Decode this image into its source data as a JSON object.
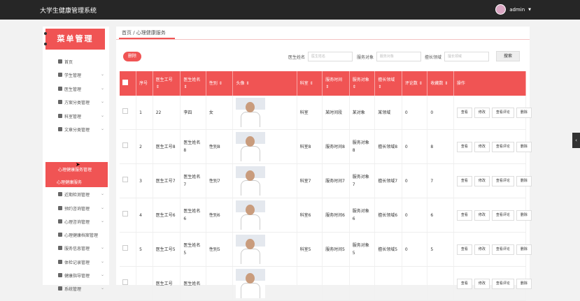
{
  "app": {
    "title": "大学生健康管理系统",
    "user": "admin"
  },
  "sidebar": {
    "banner": "菜单管理",
    "items": [
      {
        "label": "首页",
        "icon": "home-icon",
        "chev": false
      },
      {
        "label": "学生管理",
        "icon": "folder-icon",
        "chev": true
      },
      {
        "label": "医生管理",
        "icon": "user-icon",
        "chev": true
      },
      {
        "label": "方案分类管理",
        "icon": "grid-icon",
        "chev": true
      },
      {
        "label": "科室管理",
        "icon": "grid-icon",
        "chev": true
      },
      {
        "label": "文章分类管理",
        "icon": "grid-icon",
        "chev": true
      },
      {
        "label": "健康服务管理",
        "icon": "tools-icon",
        "chev": true
      },
      {
        "label": "近期检测管理",
        "icon": "grid-icon",
        "chev": true
      },
      {
        "label": "预约咨询管理",
        "icon": "lock-icon",
        "chev": true
      },
      {
        "label": "心理咨询管理",
        "icon": "grid-icon",
        "chev": true
      },
      {
        "label": "心理健康档案管理",
        "icon": "grid-icon",
        "chev": false
      },
      {
        "label": "服务信息管理",
        "icon": "grid-icon",
        "chev": true
      },
      {
        "label": "体检记录管理",
        "icon": "grid-icon",
        "chev": true
      },
      {
        "label": "健康指导管理",
        "icon": "grid-icon",
        "chev": true
      },
      {
        "label": "系统管理",
        "icon": "grid-icon",
        "chev": true
      }
    ],
    "active_group": "心理健康服务管理",
    "active_sub": "心理健康服务"
  },
  "breadcrumb": "首页 / 心理健康服务",
  "toolbar": {
    "delete_label": "删除",
    "doctor_name_label": "医生姓名",
    "doctor_name_placeholder": "医生姓名",
    "service_target_label": "服务对象",
    "service_target_placeholder": "服务对象",
    "specialty_label": "擅长领域",
    "specialty_placeholder": "擅长领域",
    "search_label": "搜索"
  },
  "table": {
    "headers": [
      "序号",
      "医生工号 ⇕",
      "医生姓名 ⇕",
      "性别 ⇕",
      "头像 ⇕",
      "科室 ⇕",
      "服务时间 ⇕",
      "服务对象 ⇕",
      "擅长领域 ⇕",
      "评论数 ⇕",
      "收藏数 ⇕",
      "操作"
    ],
    "rows": [
      [
        "1",
        "22",
        "李四",
        "女",
        "科室",
        "某时间段",
        "某对象",
        "某领域",
        "0",
        "0"
      ],
      [
        "2",
        "医生工号8",
        "医生姓名8",
        "性别8",
        "科室8",
        "服务时间8",
        "服务对象8",
        "擅长领域8",
        "0",
        "8"
      ],
      [
        "3",
        "医生工号7",
        "医生姓名7",
        "性别7",
        "科室7",
        "服务时间7",
        "服务对象7",
        "擅长领域7",
        "0",
        "7"
      ],
      [
        "4",
        "医生工号6",
        "医生姓名6",
        "性别6",
        "科室6",
        "服务时间6",
        "服务对象6",
        "擅长领域6",
        "0",
        "6"
      ],
      [
        "5",
        "医生工号5",
        "医生姓名5",
        "性别5",
        "科室5",
        "服务时间5",
        "服务对象5",
        "擅长领域5",
        "0",
        "5"
      ],
      [
        "",
        "医生工号",
        "医生姓名",
        "",
        "",
        "",
        "",
        "",
        "",
        ""
      ]
    ],
    "ops": [
      "查看",
      "修改",
      "查看评论",
      "删除"
    ]
  }
}
